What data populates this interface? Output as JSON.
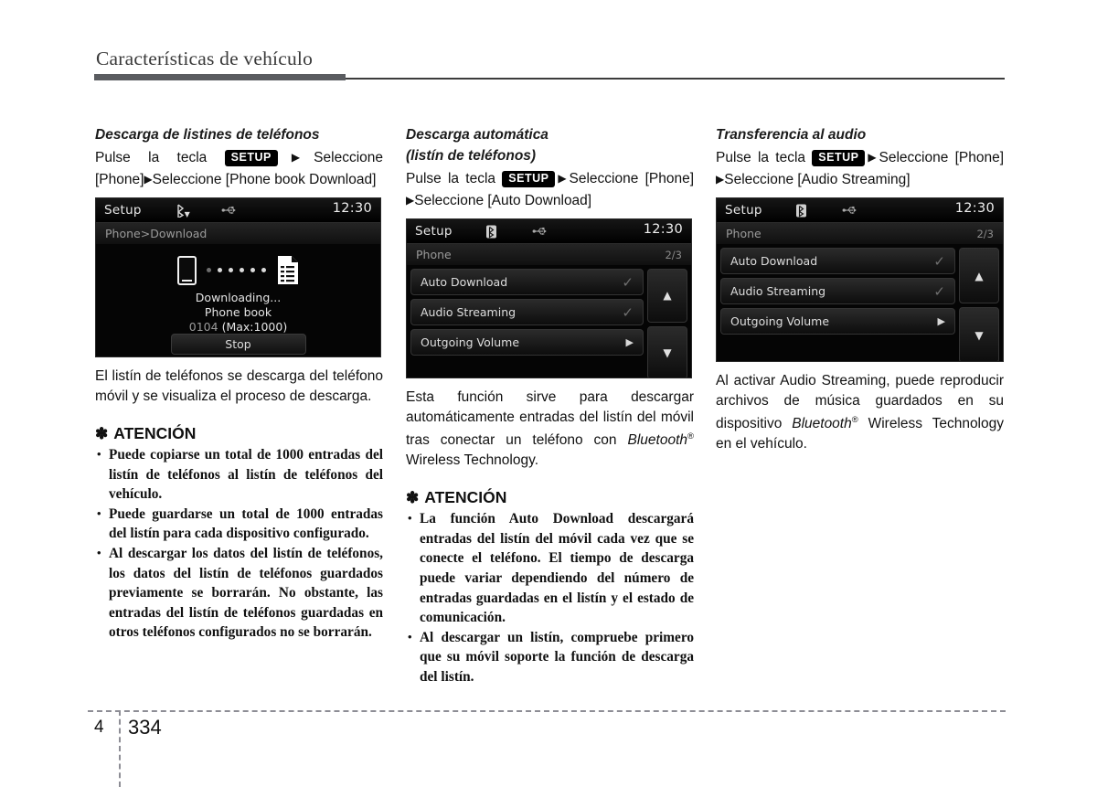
{
  "page": {
    "header_title": "Características de vehículo",
    "chapter": "4",
    "page_number": "334"
  },
  "labels": {
    "press_key": "Pulse la tecla",
    "setup_badge": "SETUP",
    "select": "Seleccione",
    "phone_bracket": "[Phone]",
    "arrow": "▶",
    "asterisk": "✽",
    "attention": "ATENCIÓN"
  },
  "columns": [
    {
      "title": "Descarga de listines de teléfonos",
      "steps_tail_1": "[Phone]",
      "steps_tail_2": "Seleccione  [Phone  book Download]",
      "screen": {
        "type": "download",
        "app_name": "Setup",
        "clock": "12:30",
        "bt_icon": "bluetooth-download-icon",
        "usb_icon": "usb-icon",
        "breadcrumb": "Phone>Download",
        "status_line1": "Downloading...",
        "status_line2": "Phone book",
        "count": "0104",
        "count_max": "(Max:1000)",
        "button_label": "Stop"
      },
      "paragraph": "El listín de teléfonos se descarga del teléfono móvil y se visualiza el proceso de descarga.",
      "attention": [
        "Puede copiarse un total de 1000 entradas del listín de teléfonos al listín de teléfonos del vehículo.",
        "Puede guardarse un total de 1000 entradas del listín para cada dispositivo configurado.",
        "Al descargar los datos del listín de teléfonos, los datos del listín de teléfonos guardados previamente se borrarán. No obstante, las entradas del listín de teléfonos guardadas en otros teléfonos configurados no se borrarán."
      ]
    },
    {
      "title_line1": "Descarga automática",
      "title_line2": "(listín de teléfonos)",
      "steps_tail": "Seleccione [Auto Download]",
      "screen": {
        "type": "list",
        "app_name": "Setup",
        "clock": "12:30",
        "bt_icon": "bluetooth-icon",
        "usb_icon": "usb-icon",
        "breadcrumb": "Phone",
        "page_indicator": "2/3",
        "items": [
          {
            "label": "Auto Download",
            "control": "check"
          },
          {
            "label": "Audio Streaming",
            "control": "check"
          },
          {
            "label": "Outgoing Volume",
            "control": "arrow"
          }
        ],
        "scroll_up": "▲",
        "scroll_down": "▼",
        "back_glyph": "⤺"
      },
      "paragraph_pre": "Esta función sirve para descargar automáticamente entradas del listín del móvil tras conectar un teléfono con ",
      "paragraph_bt": "Bluetooth",
      "paragraph_post": " Wireless Technology.",
      "attention": [
        "La función Auto Download descargará entradas del listín del móvil cada vez que se conecte el teléfono. El tiempo de descarga puede variar dependiendo del número de entradas guardadas en el listín y el estado de comunicación.",
        "Al descargar un listín, compruebe primero que su móvil soporte la función de descarga del listín."
      ]
    },
    {
      "title": "Transferencia al audio",
      "steps_tail": "Seleccione [Audio Streaming]",
      "screen": {
        "type": "list",
        "app_name": "Setup",
        "clock": "12:30",
        "bt_icon": "bluetooth-icon",
        "usb_icon": "usb-icon",
        "breadcrumb": "Phone",
        "page_indicator": "2/3",
        "items": [
          {
            "label": "Auto Download",
            "control": "check"
          },
          {
            "label": "Audio Streaming",
            "control": "check"
          },
          {
            "label": "Outgoing Volume",
            "control": "arrow"
          }
        ],
        "scroll_up": "▲",
        "scroll_down": "▼",
        "back_glyph": "⤺"
      },
      "paragraph_pre": "Al activar Audio Streaming, puede reproducir archivos de música guardados en su dispositivo ",
      "paragraph_bt": "Bluetooth",
      "paragraph_post": " Wireless Technology en el vehículo."
    }
  ]
}
